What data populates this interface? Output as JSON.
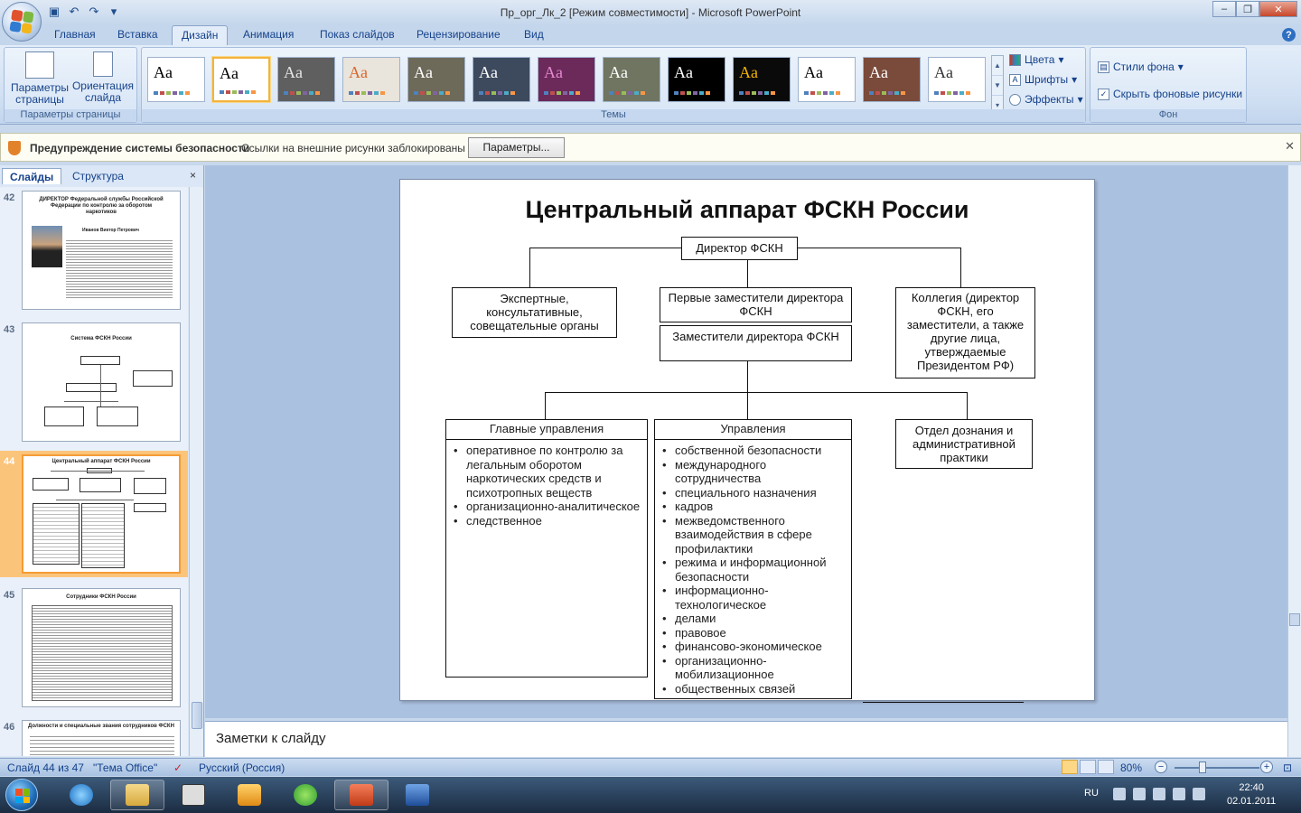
{
  "app": {
    "title": "Пр_орг_Лк_2 [Режим совместимости] - Microsoft PowerPoint",
    "tabs": [
      "Главная",
      "Вставка",
      "Дизайн",
      "Анимация",
      "Показ слайдов",
      "Рецензирование",
      "Вид"
    ],
    "active_tab": "Дизайн"
  },
  "ribbon": {
    "page_setup": {
      "params_label": "Параметры страницы",
      "orientation_label": "Ориентация слайда",
      "group_label": "Параметры страницы"
    },
    "themes": {
      "group_label": "Темы",
      "items": [
        {
          "label": "Aa",
          "bg": "#ffffff",
          "fg": "#000000"
        },
        {
          "label": "Aa",
          "bg": "#ffffff",
          "fg": "#000000"
        },
        {
          "label": "Aa",
          "bg": "#5f5f5f",
          "fg": "#e6e6e6"
        },
        {
          "label": "Aa",
          "bg": "#e9e4dc",
          "fg": "#d9672b"
        },
        {
          "label": "Aa",
          "bg": "#6d6a5a",
          "fg": "#ffffff"
        },
        {
          "label": "Aa",
          "bg": "#3d4a5e",
          "fg": "#ffffff"
        },
        {
          "label": "Aa",
          "bg": "#6b2a5a",
          "fg": "#e68ad0"
        },
        {
          "label": "Aa",
          "bg": "#6f7560",
          "fg": "#ffffff"
        },
        {
          "label": "Aa",
          "bg": "#000000",
          "fg": "#ffffff"
        },
        {
          "label": "Aa",
          "bg": "#0a0a0a",
          "fg": "#f5b400"
        },
        {
          "label": "Aa",
          "bg": "#ffffff",
          "fg": "#000000"
        },
        {
          "label": "Aa",
          "bg": "#7a4a3a",
          "fg": "#ffffff"
        },
        {
          "label": "Aa",
          "bg": "#ffffff",
          "fg": "#333333"
        }
      ],
      "colors_label": "Цвета",
      "fonts_label": "Шрифты",
      "effects_label": "Эффекты"
    },
    "background": {
      "styles_label": "Стили фона",
      "hide_label": "Скрыть фоновые рисунки",
      "group_label": "Фон"
    }
  },
  "security": {
    "title": "Предупреждение системы безопасности",
    "message": "Ссылки на внешние рисунки заблокированы",
    "button": "Параметры..."
  },
  "left_panel": {
    "tab_slides": "Слайды",
    "tab_outline": "Структура",
    "close": "×",
    "thumbs": [
      {
        "num": "42",
        "title": "ДИРЕКТОР Федеральной службы Российской Федерации по контролю за оборотом наркотиков",
        "person": "Иванов Виктор Петрович"
      },
      {
        "num": "43",
        "title": "Система ФСКН России"
      },
      {
        "num": "44",
        "title": "Центральный аппарат ФСКН России"
      },
      {
        "num": "45",
        "title": "Сотрудники ФСКН России"
      },
      {
        "num": "46",
        "title": "Должности и специальные звания сотрудников ФСКН"
      }
    ]
  },
  "slide": {
    "title": "Центральный аппарат ФСКН России",
    "director": "Директор ФСКН",
    "experts": "Экспертные, консультативные, совещательные органы",
    "first_deputies": "Первые заместители директора ФСКН",
    "deputies": "Заместители директора ФСКН",
    "collegium": "Коллегия (директор ФСКН, его заместители, а также другие лица, утверждаемые Президентом РФ)",
    "main_dirs": {
      "head": "Главные управления",
      "items": [
        "оперативное по контролю за легальным оборотом наркотических средств и психотропных веществ",
        "организационно-аналитическое",
        "следственное"
      ]
    },
    "dirs": {
      "head": "Управления",
      "items": [
        "собственной безопасности",
        "международного сотрудничества",
        "специального назначения",
        "кадров",
        "межведомственного взаимодействия в сфере профилактики",
        "режима и информационной безопасности",
        "информационно-технологическое",
        "делами",
        "правовое",
        "финансово-экономическое",
        "организационно-мобилизационное",
        "общественных связей"
      ]
    },
    "inquiry": "Отдел дознания и административной практики"
  },
  "notes": {
    "placeholder": "Заметки к слайду"
  },
  "status": {
    "slide": "Слайд 44 из 47",
    "theme": "\"Тема Office\"",
    "language": "Русский (Россия)",
    "zoom": "80%"
  },
  "taskbar": {
    "lang": "RU",
    "time": "22:40",
    "date": "02.01.2011"
  }
}
